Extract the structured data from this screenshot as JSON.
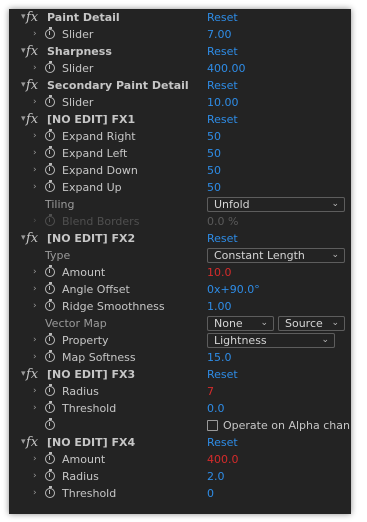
{
  "effects": [
    {
      "name": "Paint Detail",
      "reset": "Reset",
      "params": [
        {
          "label": "Slider",
          "value": "7.00",
          "color": "#2e8ce6"
        }
      ]
    },
    {
      "name": "Sharpness",
      "reset": "Reset",
      "params": [
        {
          "label": "Slider",
          "value": "400.00",
          "color": "#2e8ce6"
        }
      ]
    },
    {
      "name": "Secondary Paint Detail",
      "reset": "Reset",
      "params": [
        {
          "label": "Slider",
          "value": "10.00",
          "color": "#2e8ce6"
        }
      ]
    },
    {
      "name": "[NO EDIT] FX1",
      "reset": "Reset",
      "params": [
        {
          "label": "Expand Right",
          "value": "50",
          "color": "#2e8ce6"
        },
        {
          "label": "Expand Left",
          "value": "50",
          "color": "#2e8ce6"
        },
        {
          "label": "Expand Down",
          "value": "50",
          "color": "#2e8ce6"
        },
        {
          "label": "Expand Up",
          "value": "50",
          "color": "#2e8ce6"
        },
        {
          "label": "Tiling",
          "dropdown": "Unfold"
        },
        {
          "label": "Blend Borders",
          "value": "0.0 %",
          "disabled": true
        }
      ]
    },
    {
      "name": "[NO EDIT] FX2",
      "reset": "Reset",
      "params": [
        {
          "label": "Type",
          "dropdown": "Constant Length"
        },
        {
          "label": "Amount",
          "value": "10.0",
          "color": "#d52b2b"
        },
        {
          "label": "Angle Offset",
          "value": "0x+90.0°",
          "color": "#2e8ce6"
        },
        {
          "label": "Ridge Smoothness",
          "value": "1.00",
          "color": "#2e8ce6"
        },
        {
          "label": "Vector Map",
          "dropdowns": [
            "None",
            "Source"
          ]
        },
        {
          "label": "Property",
          "dropdown": "Lightness"
        },
        {
          "label": "Map Softness",
          "value": "15.0",
          "color": "#2e8ce6"
        }
      ]
    },
    {
      "name": "[NO EDIT] FX3",
      "reset": "Reset",
      "params": [
        {
          "label": "Radius",
          "value": "7",
          "color": "#d52b2b"
        },
        {
          "label": "Threshold",
          "value": "0.0",
          "color": "#2e8ce6"
        },
        {
          "label": "",
          "checkbox": "Operate on Alpha chann"
        }
      ]
    },
    {
      "name": "[NO EDIT] FX4",
      "reset": "Reset",
      "params": [
        {
          "label": "Amount",
          "value": "400.0",
          "color": "#d52b2b"
        },
        {
          "label": "Radius",
          "value": "2.0",
          "color": "#2e8ce6"
        },
        {
          "label": "Threshold",
          "value": "0",
          "color": "#2e8ce6"
        }
      ]
    }
  ],
  "icons": {
    "twirl_open": "▾",
    "twirl_closed": "›",
    "fx": "fx",
    "stopwatch": "stopwatch-icon",
    "dropdown_chevron": "⌄"
  },
  "colors": {
    "panel_bg": "#232323",
    "label": "#c6c6c6",
    "value_blue": "#2e8ce6",
    "value_red": "#d52b2b",
    "disabled": "#4f4f4f"
  }
}
